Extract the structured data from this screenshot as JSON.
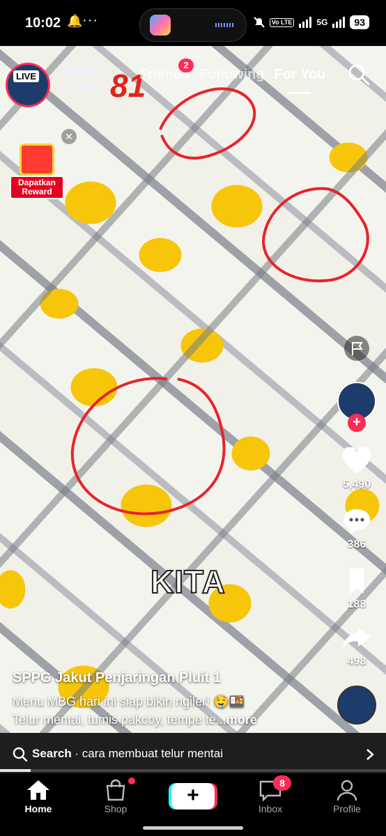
{
  "status_bar": {
    "time": "10:02",
    "volte": "Vo LTE",
    "network": "5G",
    "battery": "93"
  },
  "header": {
    "live_label": "LIVE",
    "account_line1": "PLUIT",
    "account_line2": "KDT004",
    "logo_text": "81",
    "tabs": [
      {
        "label": "Friends",
        "badge": "2"
      },
      {
        "label": "Following"
      },
      {
        "label": "For You",
        "active": true
      }
    ]
  },
  "reward": {
    "label": "Dapatkan Reward"
  },
  "video": {
    "overlay_text": "KITA"
  },
  "rail": {
    "likes": "5,490",
    "comments": "386",
    "saves": "188",
    "shares": "498"
  },
  "post": {
    "author": "SPPG Jakut Penjaringan Pluit 1",
    "line1": "Menu MBG hari ini siap bikin ngiler! 🤤🍱",
    "line2": "Telur mentai, tumis pakcoy, tempe te...",
    "more": "more"
  },
  "search_suggest": {
    "prefix": "Search",
    "query": " · cara membuat telur mentai"
  },
  "playback": {
    "progress": 0.08
  },
  "nav": {
    "home": "Home",
    "shop": "Shop",
    "inbox": "Inbox",
    "inbox_badge": "8",
    "profile": "Profile"
  },
  "colors": {
    "accent": "#fe2c55",
    "cyan": "#25f4ee",
    "circle": "#e8232a"
  }
}
